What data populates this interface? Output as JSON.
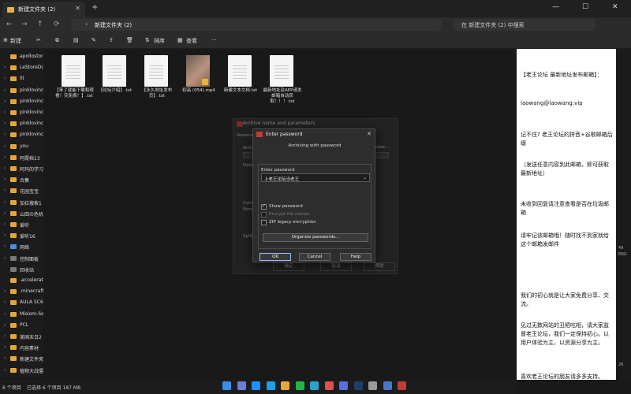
{
  "window": {
    "tab_title": "新建文件夹 (2)",
    "tab_close": "✕",
    "new_tab": "+",
    "minimize": "—",
    "maximize": "☐",
    "close": "✕"
  },
  "nav": {
    "back": "←",
    "forward": "→",
    "up": "↑",
    "refresh": "⟳",
    "path_chevron": "›",
    "path": "新建文件夹 (2)",
    "search_placeholder": "在 新建文件夹 (2) 中搜索"
  },
  "toolbar": {
    "new": "新建",
    "sort": "排序",
    "view": "查看",
    "more": "···"
  },
  "sidebar": {
    "items": [
      {
        "label": "apollostor",
        "icon": "folder-icon"
      },
      {
        "label": "LeStoreDc",
        "icon": "folder-icon"
      },
      {
        "label": "lit",
        "icon": "folder-icon"
      },
      {
        "label": "pinklovinc",
        "icon": "folder-icon"
      },
      {
        "label": "pinklovinc",
        "icon": "folder-icon"
      },
      {
        "label": "pinklovinc",
        "icon": "folder-icon"
      },
      {
        "label": "pinklovinc",
        "icon": "folder-icon"
      },
      {
        "label": "pinklovinc",
        "icon": "folder-icon"
      },
      {
        "label": "you",
        "icon": "folder-icon"
      },
      {
        "label": "阿霞档13",
        "icon": "folder-icon"
      },
      {
        "label": "阿玛的学习",
        "icon": "folder-icon"
      },
      {
        "label": "合集",
        "icon": "folder-icon"
      },
      {
        "label": "花园宝宝",
        "icon": "folder-icon"
      },
      {
        "label": "加拉搜索1",
        "icon": "folder-icon"
      },
      {
        "label": "山田の危机",
        "icon": "folder-icon"
      },
      {
        "label": "爱听",
        "icon": "folder-icon"
      },
      {
        "label": "爱听16",
        "icon": "folder-icon"
      },
      {
        "label": "网络",
        "icon": "network-icon"
      },
      {
        "label": "控制面板",
        "icon": "control-panel-icon"
      },
      {
        "label": "回收站",
        "icon": "recycle-bin-icon"
      },
      {
        "label": ".accelerate",
        "icon": "folder-icon"
      },
      {
        "label": ".minecraft",
        "icon": "folder-icon"
      },
      {
        "label": "AULA SC68",
        "icon": "folder-icon"
      },
      {
        "label": "Misiom-Sor",
        "icon": "folder-icon"
      },
      {
        "label": "PCL",
        "icon": "folder-icon"
      },
      {
        "label": "美国末日2",
        "icon": "folder-icon"
      },
      {
        "label": "内容素材",
        "icon": "folder-icon"
      },
      {
        "label": "新建文件夹",
        "icon": "folder-icon"
      },
      {
        "label": "植物大战僵",
        "icon": "folder-icon"
      }
    ]
  },
  "files": [
    {
      "name": "【来了就能下载和观看！完免费！】.txt",
      "type": "txt"
    },
    {
      "name": "【论坛介绍】.txt",
      "type": "txt"
    },
    {
      "name": "【永久地址发布页】.txt",
      "type": "txt"
    },
    {
      "name": "初高 (054).mp4",
      "type": "video"
    },
    {
      "name": "新建文本文档.txt",
      "type": "txt"
    },
    {
      "name": "最新地址及APP请发邮箱自动获取！！！.txt",
      "type": "txt"
    }
  ],
  "bg_dialog": {
    "title": "Archive name and parameters",
    "tab": "General",
    "archive_label": "Archive",
    "default_label": "Default",
    "compress_label": "Compress",
    "normal": "Normal",
    "split_label": "Split to",
    "browse": "Browse...",
    "ok": "确定",
    "cancel": "取消",
    "help": "帮助"
  },
  "dialog": {
    "title": "Enter password",
    "close": "✕",
    "subtitle": "Archiving with password",
    "enter_label": "Enter password",
    "password_value": "上老王论坛当老王",
    "show_password": "Show password",
    "encrypt_names": "Encrypt file names",
    "zip_legacy": "ZIP legacy encryption",
    "organize": "Organize passwords...",
    "ok": "OK",
    "cancel": "Cancel",
    "help": "Help"
  },
  "notepad": {
    "lines": [
      "【老王论坛 最新地址发布邮箱】：",
      "laowang@laowang.vip",
      "记不住? 老王论坛的拼音+谷歌邮箱后缀",
      "（发送任意内容到此邮箱，即可获取最新地址）",
      "未收到回复请注意查看是否在垃圾邮箱",
      "请牢记该邮箱哦！随时找不到家就给这个邮箱发邮件",
      "我们的初心就是让大家免费分享、交流。",
      "见过无数网站的丑陋吃相，请大家监督老王论坛，我们一定保持初心。以用户体验为主，以资源分享为主。",
      "喜欢老王论坛的朋友请多多支持。"
    ]
  },
  "right_strip": {
    "texts": [
      "49",
      "ENG",
      "26"
    ]
  },
  "status": {
    "count": "6 个项目",
    "selected": "已选择 6 个项目 187 MB"
  },
  "taskbar": {
    "icons": [
      "windows-icon",
      "search-icon",
      "task-view-icon",
      "edge-icon",
      "explorer-icon",
      "wechat-icon",
      "app-icon",
      "music-icon",
      "store-icon",
      "steam-icon",
      "settings-icon",
      "photos-icon",
      "winrar-icon"
    ],
    "colors": [
      "#3a8ee6",
      "#6e7bd8",
      "#1e90ff",
      "#1fa0e6",
      "#e3a73a",
      "#24b24b",
      "#2aa3c9",
      "#e04f4f",
      "#5a6ee0",
      "#1e3f66",
      "#9a9a9a",
      "#4a78c8",
      "#c23b3b"
    ]
  }
}
